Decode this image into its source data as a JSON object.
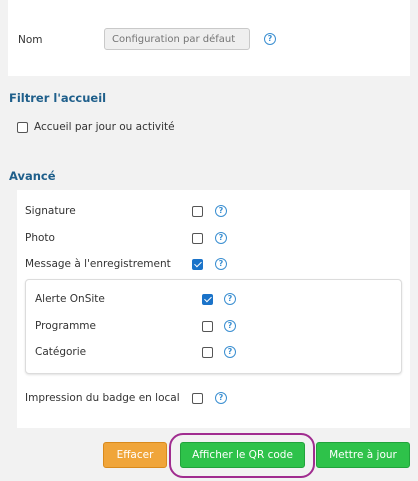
{
  "top": {
    "nom_label": "Nom",
    "nom_placeholder": "Configuration par défaut"
  },
  "filter": {
    "title": "Filtrer l'accueil",
    "option_label": "Accueil par jour ou activité",
    "option_checked": false
  },
  "advanced": {
    "title": "Avancé",
    "options": [
      {
        "label": "Signature",
        "checked": false
      },
      {
        "label": "Photo",
        "checked": false
      },
      {
        "label": "Message à l'enregistrement",
        "checked": true
      }
    ],
    "sub_options": [
      {
        "label": "Alerte OnSite",
        "checked": true
      },
      {
        "label": "Programme",
        "checked": false
      },
      {
        "label": "Catégorie",
        "checked": false
      }
    ],
    "local_print_label": "Impression du badge en local",
    "local_print_checked": false
  },
  "help_glyph": "?",
  "buttons": {
    "clear": "Effacer",
    "show_qr": "Afficher le QR code",
    "update": "Mettre à jour"
  },
  "colors": {
    "section_title": "#1f5f8b",
    "help_icon": "#3b8fd1",
    "checkbox_checked": "#1a73c9",
    "clear_button": "#f0a53a",
    "green_button": "#2ec24a",
    "highlight": "#a02c8f"
  }
}
